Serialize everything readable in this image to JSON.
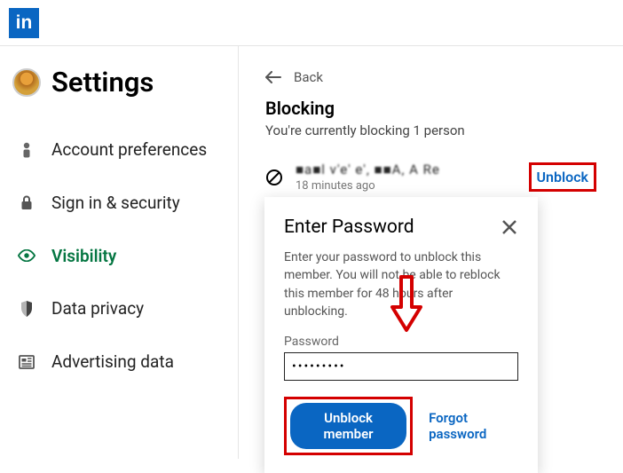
{
  "app": {
    "logo_text": "in"
  },
  "sidebar": {
    "title": "Settings",
    "items": [
      {
        "label": "Account preferences"
      },
      {
        "label": "Sign in & security"
      },
      {
        "label": "Visibility"
      },
      {
        "label": "Data privacy"
      },
      {
        "label": "Advertising data"
      }
    ]
  },
  "main": {
    "back_label": "Back",
    "title": "Blocking",
    "subtitle": "You're currently blocking 1 person",
    "blocked": {
      "name": "■a■l v'e' e', ■■A, A Re",
      "time": "18 minutes ago"
    },
    "unblock_label": "Unblock"
  },
  "modal": {
    "title": "Enter Password",
    "text": "Enter your password to unblock this member. You will not be able to reblock this member for 48 hours after unblocking.",
    "pwd_label": "Password",
    "pwd_value": "•••••••••",
    "submit_label": "Unblock member",
    "forgot_label": "Forgot password"
  }
}
